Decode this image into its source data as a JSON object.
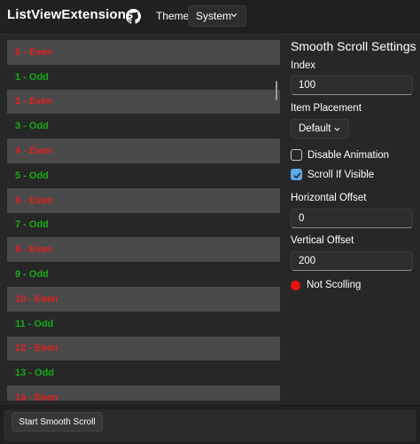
{
  "app": {
    "title": "ListViewExtensions",
    "github_icon": "github-icon",
    "theme_label": "Theme",
    "theme_value": "System"
  },
  "list": {
    "items": [
      {
        "label": "0 - Even",
        "kind": "even"
      },
      {
        "label": "1 - Odd",
        "kind": "odd"
      },
      {
        "label": "2 - Even",
        "kind": "even"
      },
      {
        "label": "3 - Odd",
        "kind": "odd"
      },
      {
        "label": "4 - Even",
        "kind": "even"
      },
      {
        "label": "5 - Odd",
        "kind": "odd"
      },
      {
        "label": "6 - Even",
        "kind": "even"
      },
      {
        "label": "7 - Odd",
        "kind": "odd"
      },
      {
        "label": "8 - Even",
        "kind": "even"
      },
      {
        "label": "9 - Odd",
        "kind": "odd"
      },
      {
        "label": "10 - Even",
        "kind": "even"
      },
      {
        "label": "11 - Odd",
        "kind": "odd"
      },
      {
        "label": "12 - Even",
        "kind": "even"
      },
      {
        "label": "13 - Odd",
        "kind": "odd"
      },
      {
        "label": "14 - Even",
        "kind": "even"
      }
    ],
    "even_color": "#e02020",
    "odd_color": "#18a818"
  },
  "settings": {
    "title": "Smooth Scroll Settings",
    "index_label": "Index",
    "index_value": "100",
    "placement_label": "Item Placement",
    "placement_value": "Default",
    "disable_animation_label": "Disable Animation",
    "disable_animation_checked": false,
    "scroll_if_visible_label": "Scroll If Visible",
    "scroll_if_visible_checked": true,
    "horizontal_offset_label": "Horizontal Offset",
    "horizontal_offset_value": "0",
    "vertical_offset_label": "Vertical Offset",
    "vertical_offset_value": "200",
    "status_text": "Not Scolling",
    "status_color": "#e81010"
  },
  "footer": {
    "start_button_label": "Start Smooth Scroll"
  }
}
